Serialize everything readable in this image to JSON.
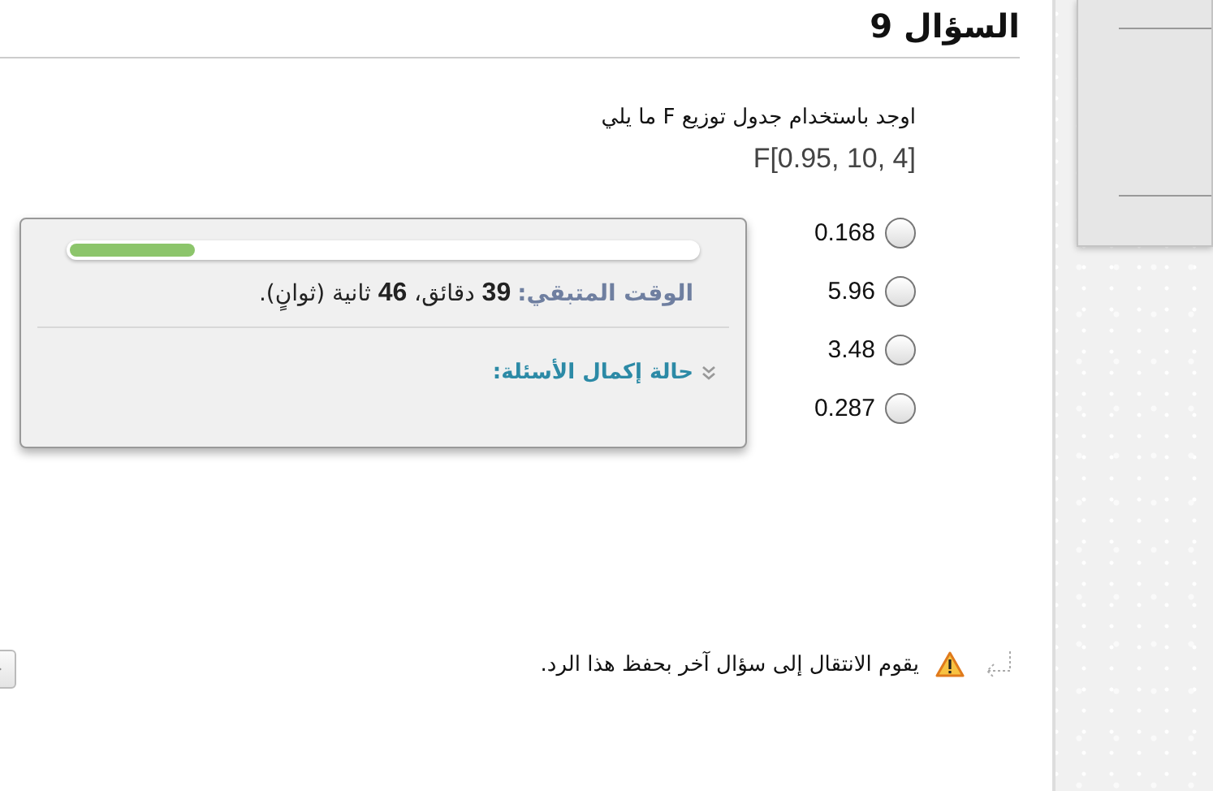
{
  "question": {
    "title": "السؤال 9",
    "prompt": "اوجد باستخدام جدول توزيع F ما يلي",
    "expression": "F[0.95, 10, 4]",
    "options": [
      {
        "label": "0.168",
        "selected": false
      },
      {
        "label": "5.96",
        "selected": false
      },
      {
        "label": "3.48",
        "selected": false
      },
      {
        "label": "0.287",
        "selected": false
      }
    ]
  },
  "timer": {
    "level": 0.2,
    "label": "الوقت المتبقي:",
    "remaining": "**39** دقائق، **46** ثانية (ثوانٍ).",
    "status_link": "حالة إكمال الأسئلة:",
    "expanded": false
  },
  "note": "يقوم الانتقال إلى سؤال آخر بحفظ هذا الرد."
}
